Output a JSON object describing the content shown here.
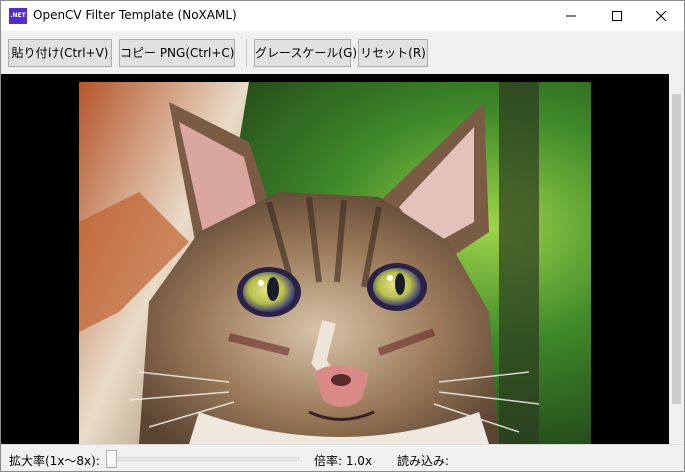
{
  "window": {
    "title": "OpenCV Filter Template (NoXAML)",
    "app_icon_text": ".NET",
    "app_icon_color": "#512bd4"
  },
  "toolbar": {
    "buttons": [
      {
        "label": "貼り付け(Ctrl+V)"
      },
      {
        "label": "コピー PNG(Ctrl+C)"
      },
      {
        "label": "グレースケール(G)"
      },
      {
        "label": "リセット(R)"
      }
    ]
  },
  "viewer": {
    "background": "#000000",
    "image_subject": "cat-photo"
  },
  "statusbar": {
    "zoom_label": "拡大率(1x〜8x):",
    "zoom_value": 1.0,
    "zoom_range": [
      1,
      8
    ],
    "rate_text": "倍率: 1.0x",
    "load_text": "読み込み:"
  }
}
